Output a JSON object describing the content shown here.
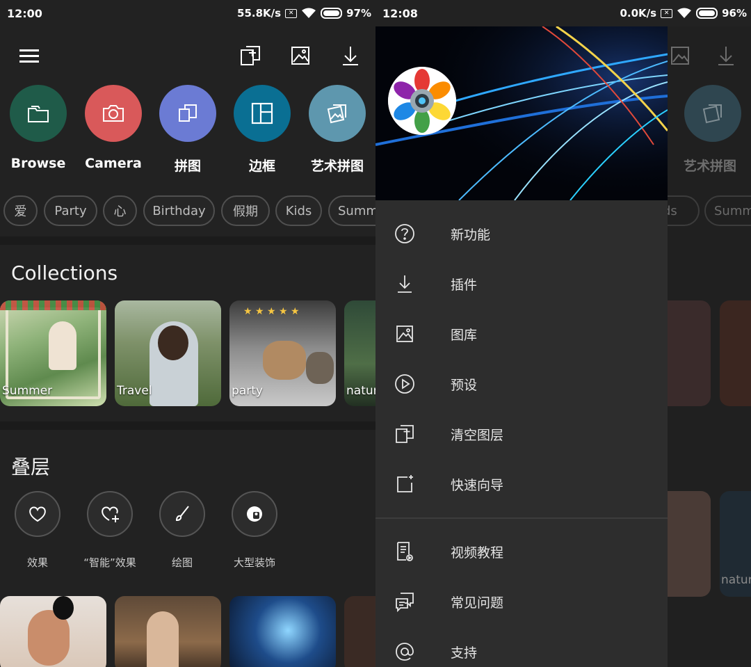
{
  "left": {
    "status": {
      "time": "12:00",
      "speed": "55.8K/s",
      "battery": "97%"
    },
    "quick_actions": [
      {
        "label": "Browse",
        "icon": "folder-icon",
        "color": "#1f5b49"
      },
      {
        "label": "Camera",
        "icon": "camera-icon",
        "color": "#d9595a"
      },
      {
        "label": "拼图",
        "icon": "collage-icon",
        "color": "#6b7bd4"
      },
      {
        "label": "边框",
        "icon": "frame-icon",
        "color": "#0a6f93"
      },
      {
        "label": "艺术拼图",
        "icon": "art-collage-icon",
        "color": "#5e97ae"
      }
    ],
    "tags": [
      "爱",
      "Party",
      "心",
      "Birthday",
      "假期",
      "Kids",
      "Summ"
    ],
    "collections": {
      "title": "Collections",
      "items": [
        "Summer",
        "Travel",
        "party",
        "natur"
      ]
    },
    "overlays": {
      "title": "叠层",
      "items": [
        "效果",
        "“智能”效果",
        "绘图",
        "大型装饰"
      ]
    }
  },
  "right": {
    "status": {
      "time": "12:08",
      "speed": "0.0K/s",
      "battery": "96%"
    },
    "behind": {
      "art_collage_label": "艺术拼图",
      "chips": [
        "ids",
        "Summ"
      ],
      "thumb_label": "natur"
    },
    "menu": [
      {
        "label": "新功能",
        "icon": "help-circle-icon"
      },
      {
        "label": "插件",
        "icon": "download-icon"
      },
      {
        "label": "图库",
        "icon": "image-icon"
      },
      {
        "label": "预设",
        "icon": "play-circle-icon"
      },
      {
        "label": "清空图层",
        "icon": "add-layer-icon"
      },
      {
        "label": "快速向导",
        "icon": "sparkle-frame-icon"
      }
    ],
    "menu_secondary": [
      {
        "label": "视频教程",
        "icon": "document-icon"
      },
      {
        "label": "常见问题",
        "icon": "chat-icon"
      },
      {
        "label": "支持",
        "icon": "at-icon"
      }
    ]
  }
}
